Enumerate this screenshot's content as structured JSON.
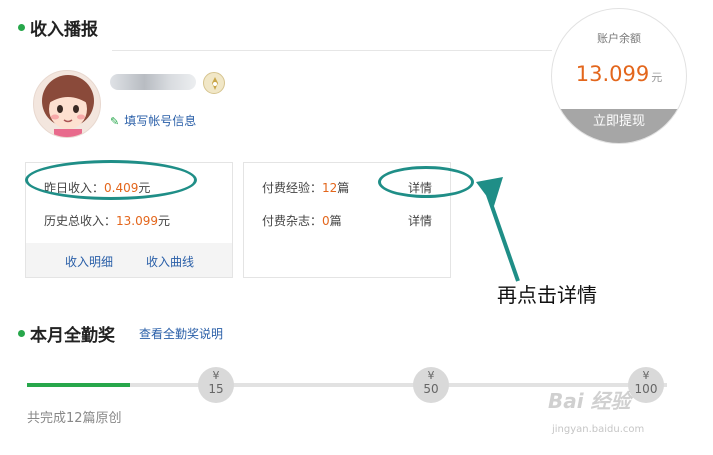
{
  "income_section": {
    "title": "收入播报",
    "edit_account_link": "填写帐号信息"
  },
  "balance": {
    "label": "账户余额",
    "amount": "13.099",
    "unit": "元",
    "withdraw_button": "立即提现"
  },
  "income_panel": {
    "yesterday_label": "昨日收入：",
    "yesterday_value": "0.409",
    "yesterday_unit": "元",
    "history_label": "历史总收入：",
    "history_value": "13.099",
    "history_unit": "元",
    "detail_link": "收入明细",
    "curve_link": "收入曲线"
  },
  "paid_panel": {
    "experience_label": "付费经验：",
    "experience_value": "12",
    "experience_unit": "篇",
    "experience_detail": "详情",
    "magazine_label": "付费杂志：",
    "magazine_value": "0",
    "magazine_unit": "篇",
    "magazine_detail": "详情"
  },
  "annotation": {
    "text": "再点击详情",
    "color": "#1f8e87"
  },
  "attendance": {
    "title": "本月全勤奖",
    "info_link": "查看全勤奖说明",
    "progress_fraction": 0.12,
    "milestones": [
      {
        "currency": "¥",
        "value": "15"
      },
      {
        "currency": "¥",
        "value": "50"
      },
      {
        "currency": "¥",
        "value": "100"
      }
    ],
    "summary": "共完成12篇原创"
  },
  "watermark": {
    "brand": "Bai 经验",
    "url": "jingyan.baidu.com"
  },
  "colors": {
    "accent_green": "#27a74b",
    "money_orange": "#e3661c",
    "link_blue": "#2a5fa8"
  }
}
